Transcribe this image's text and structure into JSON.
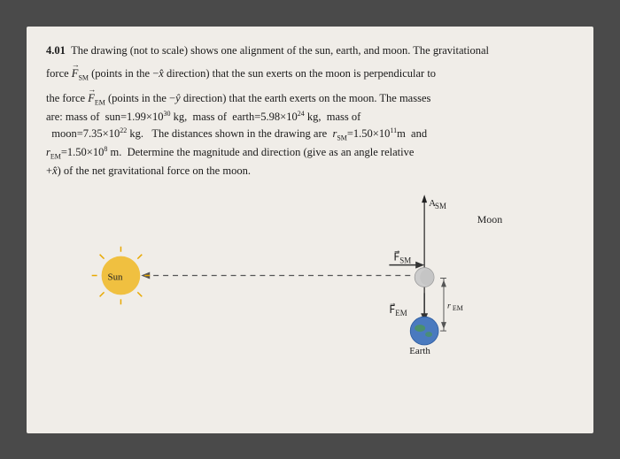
{
  "problem": {
    "number": "4.01",
    "text_line1": "The drawing (not to scale) shows one alignment of the sun, earth, and moon. The gravitational",
    "text_line2": "force F̲_SM (points in the -x̂ direction) that the sun exerts on the moon is perpendicular to",
    "text_line3": "the force F̲_EM (points in the -ŷ direction) that the earth exerts on the moon. The masses",
    "text_line4": "are: mass of  sun=1.99×10³⁰ kg,  mass of  earth=5.98×10²⁴ kg,  mass of",
    "text_line5": "moon=7.35×10²² kg.   The distances shown in the drawing are  r_SM=1.50×10¹¹ m  and",
    "text_line6": "r_EM=1.50×10⁸ m.  Determine the magnitude and direction (give as an angle relative",
    "text_line7": "+x̂) of the net gravitational force on the moon.",
    "labels": {
      "sun": "Sun",
      "moon": "Moon",
      "earth": "Earth",
      "fsm": "F⃗_SM",
      "fem": "F⃗_EM",
      "rem": "r_EM"
    }
  }
}
